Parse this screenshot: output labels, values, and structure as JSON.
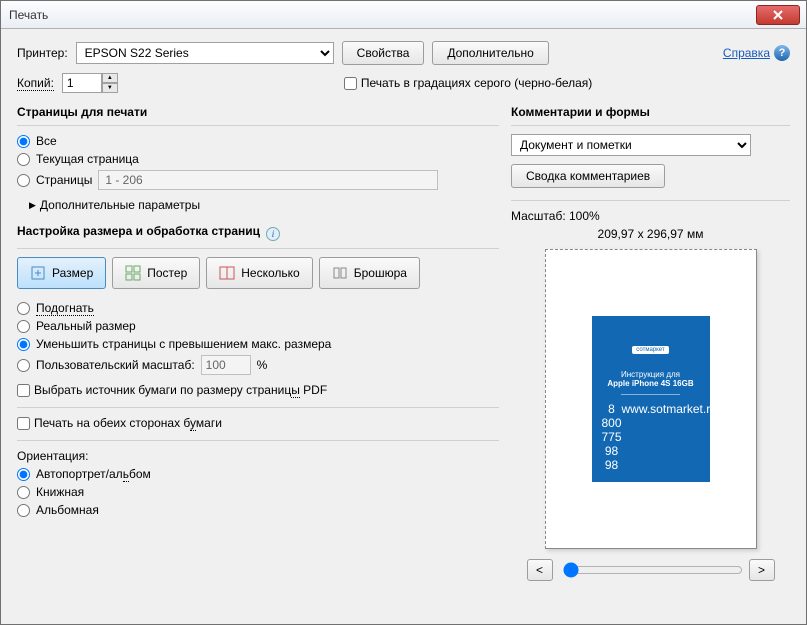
{
  "window": {
    "title": "Печать"
  },
  "top": {
    "printer_label": "Принтер:",
    "printer_value": "EPSON S22 Series",
    "properties_btn": "Свойства",
    "advanced_btn": "Дополнительно",
    "help_link": "Справка"
  },
  "row2": {
    "copies_label": "Копий:",
    "copies_value": "1",
    "grayscale_label": "Печать в градациях серого (черно-белая)"
  },
  "pages": {
    "title": "Страницы для печати",
    "all": "Все",
    "current": "Текущая страница",
    "range_label": "Страницы",
    "range_value": "1 - 206",
    "more": "Дополнительные параметры"
  },
  "sizing": {
    "title": "Настройка размера и обработка страниц",
    "tab_size": "Размер",
    "tab_poster": "Постер",
    "tab_multi": "Несколько",
    "tab_booklet": "Брошюра",
    "fit": "Подогнать",
    "actual": "Реальный размер",
    "shrink": "Уменьшить страницы с превышением макс. размера",
    "custom": "Пользовательский масштаб:",
    "custom_value": "100",
    "custom_unit": "%",
    "paper_source": "Выбрать источник бумаги по размеру страницы PDF",
    "duplex": "Печать на обеих сторонах бумаги",
    "orientation_label": "Ориентация:",
    "orient_auto": "Автопортрет/альбом",
    "orient_portrait": "Книжная",
    "orient_landscape": "Альбомная"
  },
  "comments": {
    "title": "Комментарии и формы",
    "selected": "Документ и пометки",
    "summary_btn": "Сводка комментариев"
  },
  "preview": {
    "scale_label": "Масштаб: 100%",
    "dims": "209,97 x 296,97 мм",
    "doc_logo": "сотмаркет",
    "doc_line1": "Инструкция для",
    "doc_line2": "Apple iPhone 4S 16GB",
    "doc_foot_left": "8 800 775 98 98",
    "doc_foot_right": "www.sotmarket.ru"
  }
}
